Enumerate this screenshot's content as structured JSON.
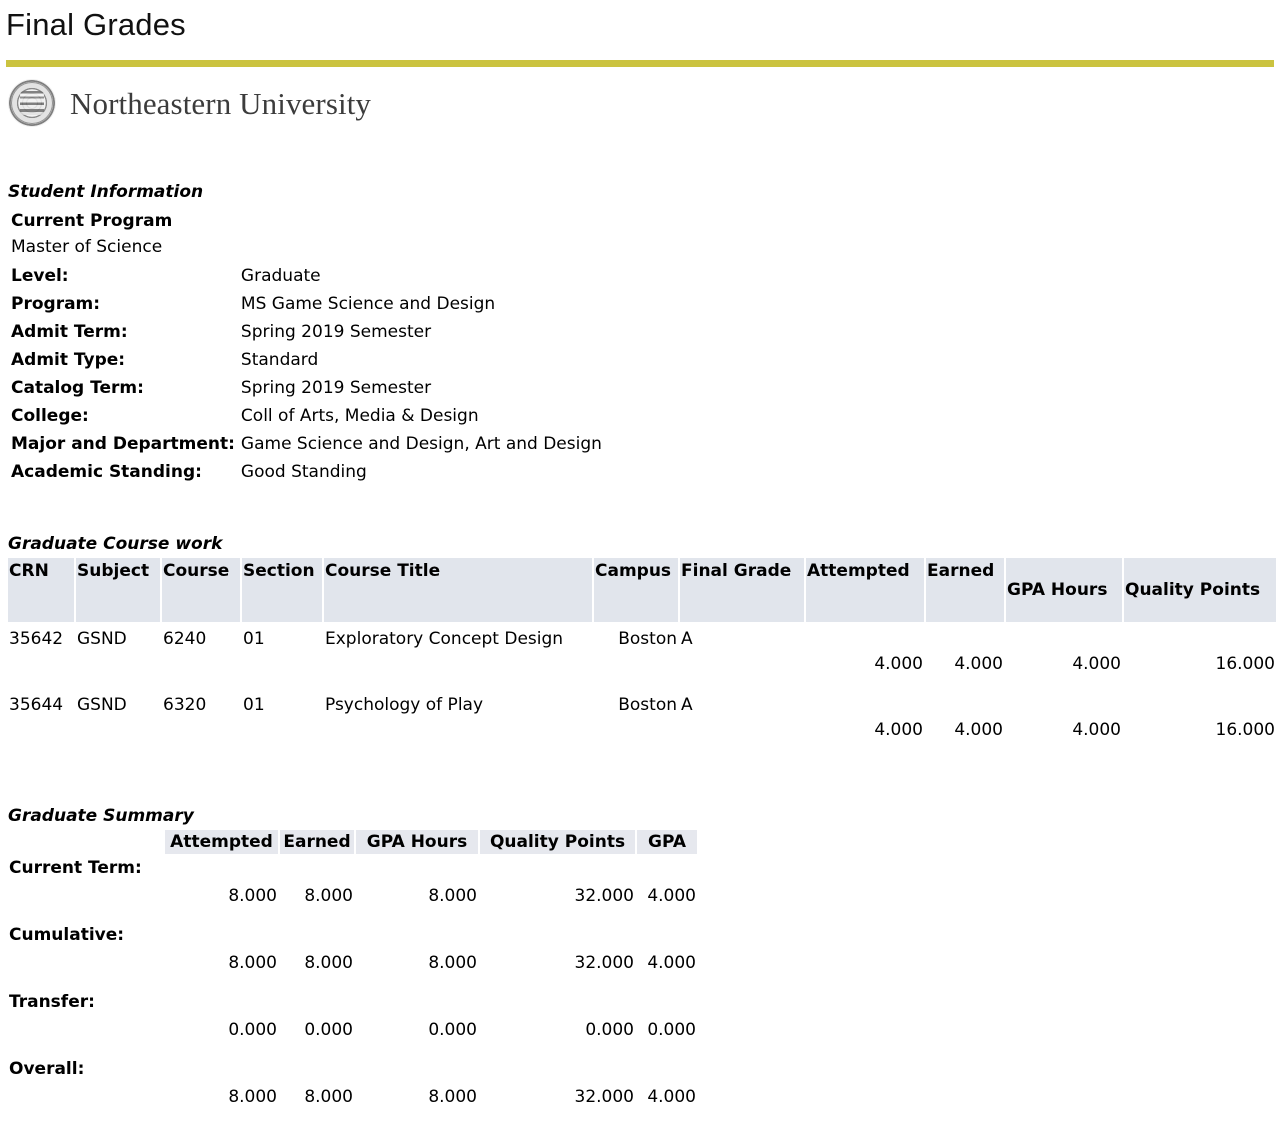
{
  "page": {
    "title": "Final Grades",
    "accent_color": "#cbc33f",
    "table_header_color": "#e1e5ec",
    "summary_header_color": "#e6e8ee"
  },
  "brand": {
    "seal_icon": "university-seal-icon",
    "name": "Northeastern University"
  },
  "student_information": {
    "heading": "Student Information",
    "current_program_label": "Current Program",
    "current_program_value": "Master of Science",
    "fields": [
      {
        "label": "Level:",
        "value": "Graduate"
      },
      {
        "label": "Program:",
        "value": "MS Game Science and Design"
      },
      {
        "label": "Admit Term:",
        "value": "Spring 2019 Semester"
      },
      {
        "label": "Admit Type:",
        "value": "Standard"
      },
      {
        "label": "Catalog Term:",
        "value": "Spring 2019 Semester"
      },
      {
        "label": "College:",
        "value": "Coll of Arts, Media & Design"
      },
      {
        "label": "Major and Department:",
        "value": "Game Science and Design, Art and Design"
      },
      {
        "label": "Academic Standing:",
        "value": "Good Standing"
      }
    ]
  },
  "coursework": {
    "heading": "Graduate Course work",
    "columns": [
      "CRN",
      "Subject",
      "Course",
      "Section",
      "Course Title",
      "Campus",
      "Final Grade",
      "Attempted",
      "Earned",
      "GPA Hours",
      "Quality Points"
    ],
    "rows": [
      {
        "crn": "35642",
        "subject": "GSND",
        "course": "6240",
        "section": "01",
        "title": "Exploratory Concept Design",
        "campus": "Boston",
        "final_grade": "A",
        "attempted": "4.000",
        "earned": "4.000",
        "gpa_hours": "4.000",
        "quality_points": "16.000"
      },
      {
        "crn": "35644",
        "subject": "GSND",
        "course": "6320",
        "section": "01",
        "title": "Psychology of Play",
        "campus": "Boston",
        "final_grade": "A",
        "attempted": "4.000",
        "earned": "4.000",
        "gpa_hours": "4.000",
        "quality_points": "16.000"
      }
    ]
  },
  "summary": {
    "heading": "Graduate Summary",
    "columns": [
      "Attempted",
      "Earned",
      "GPA Hours",
      "Quality Points",
      "GPA"
    ],
    "rows": [
      {
        "label": "Current Term:",
        "attempted": "8.000",
        "earned": "8.000",
        "gpa_hours": "8.000",
        "quality_points": "32.000",
        "gpa": "4.000"
      },
      {
        "label": "Cumulative:",
        "attempted": "8.000",
        "earned": "8.000",
        "gpa_hours": "8.000",
        "quality_points": "32.000",
        "gpa": "4.000"
      },
      {
        "label": "Transfer:",
        "attempted": "0.000",
        "earned": "0.000",
        "gpa_hours": "0.000",
        "quality_points": "0.000",
        "gpa": "0.000"
      },
      {
        "label": "Overall:",
        "attempted": "8.000",
        "earned": "8.000",
        "gpa_hours": "8.000",
        "quality_points": "32.000",
        "gpa": "4.000"
      }
    ]
  }
}
